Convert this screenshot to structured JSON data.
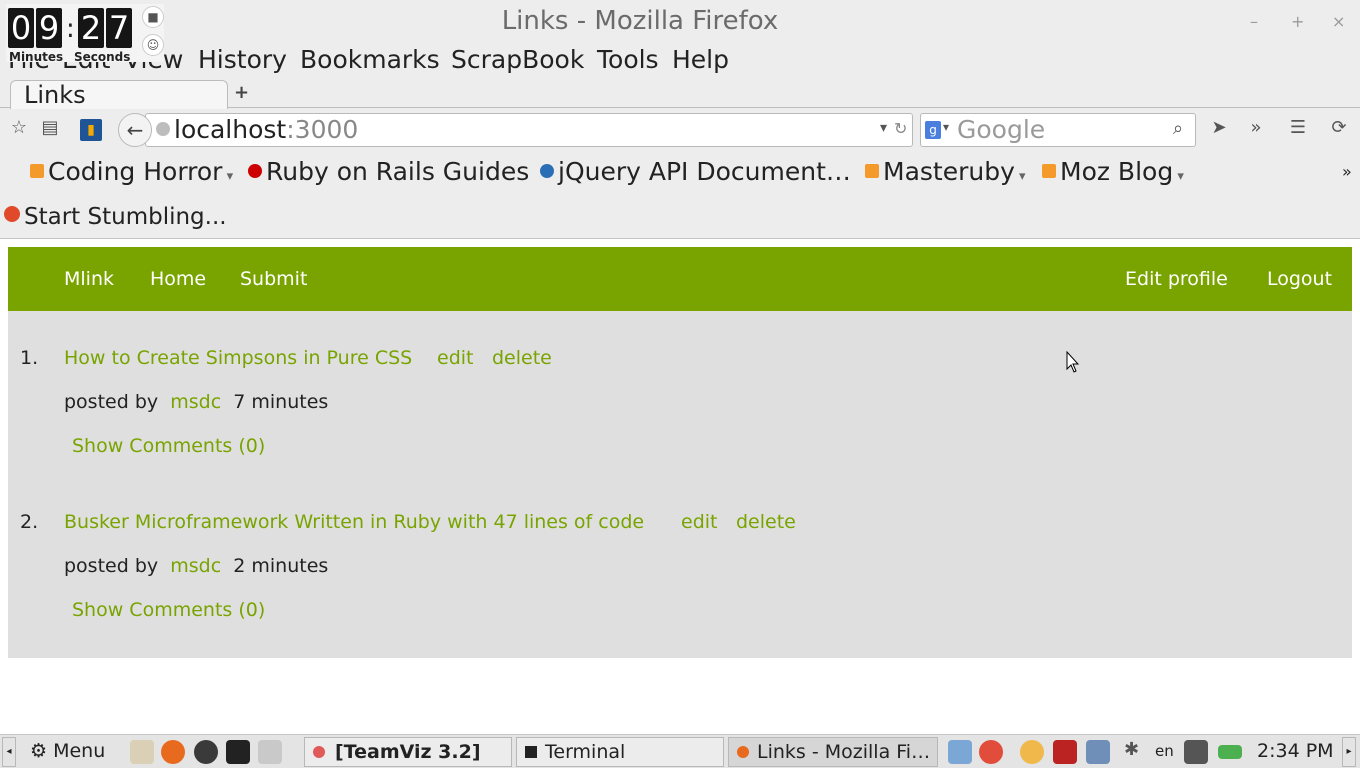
{
  "window": {
    "title": "Links - Mozilla Firefox",
    "min": "–",
    "max": "+",
    "close": "×"
  },
  "timer": {
    "minutes_d1": "0",
    "minutes_d2": "9",
    "seconds_d1": "2",
    "seconds_d2": "7",
    "minutes_label": "Minutes",
    "seconds_label": "Seconds"
  },
  "menu": {
    "file": "File",
    "edit": "Edit",
    "view": "View",
    "history": "History",
    "bookmarks": "Bookmarks",
    "scrapbook": "ScrapBook",
    "tools": "Tools",
    "help": "Help"
  },
  "tab": {
    "label": "Links",
    "new_tab": "+"
  },
  "urlbar": {
    "host": "localhost",
    "port": ":3000"
  },
  "search": {
    "placeholder": "Google"
  },
  "bookmarks": [
    {
      "label": "Coding Horror",
      "icon": "rss-icon"
    },
    {
      "label": "Ruby on Rails Guides",
      "icon": "rails-icon"
    },
    {
      "label": "jQuery API Document…",
      "icon": "jquery-icon"
    },
    {
      "label": "Masteruby",
      "icon": "rss-icon"
    },
    {
      "label": "Moz Blog",
      "icon": "rss-icon"
    }
  ],
  "overflow": "»",
  "stumble": {
    "label": "Start Stumbling..."
  },
  "site": {
    "nav_left": [
      "Mlink",
      "Home",
      "Submit"
    ],
    "nav_right": [
      "Edit profile",
      "Logout"
    ],
    "accent": "#79a400",
    "links": [
      {
        "num": "1.",
        "title": "How to Create Simpsons in Pure CSS",
        "edit": "edit",
        "delete": "delete",
        "posted_by": "posted by",
        "user": "msdc",
        "age": "7 minutes",
        "comments": "Show Comments (0)"
      },
      {
        "num": "2.",
        "title": "Busker Microframework Written in Ruby with 47 lines of code",
        "edit": "edit",
        "delete": "delete",
        "posted_by": "posted by",
        "user": "msdc",
        "age": "2 minutes",
        "comments": "Show Comments (0)"
      }
    ]
  },
  "taskbar": {
    "menu": "Menu",
    "tasks": [
      "[TeamViz 3.2]",
      "Terminal",
      "Links - Mozilla Fi…"
    ],
    "lang": "en",
    "clock": "2:34 PM"
  }
}
